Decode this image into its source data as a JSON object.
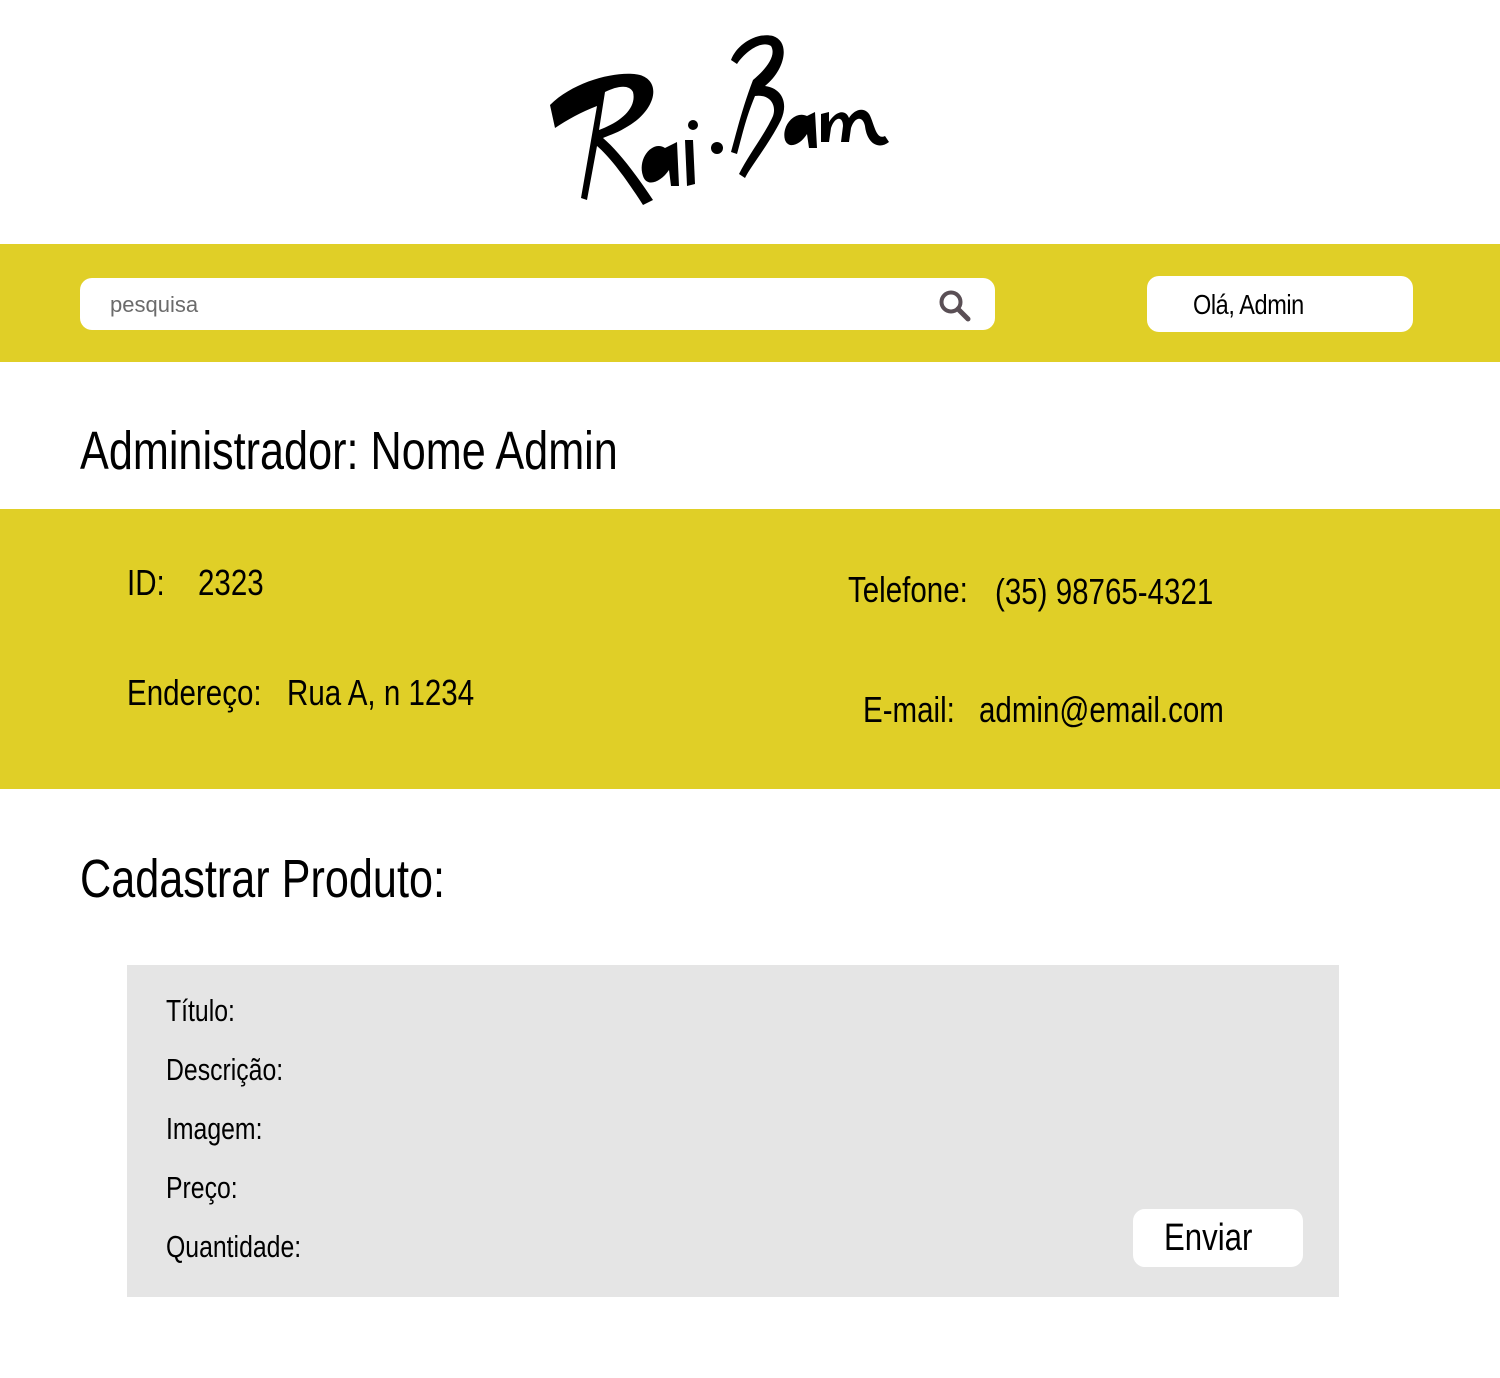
{
  "brand": {
    "logo_text": "Rai-Bam"
  },
  "header": {
    "search": {
      "placeholder": "pesquisa"
    },
    "user_greeting": "Olá, Admin"
  },
  "admin": {
    "title": "Administrador: Nome Admin",
    "fields": {
      "id_label": "ID:",
      "id_value": "2323",
      "address_label": "Endereço:",
      "address_value": "Rua A, n 1234",
      "phone_label": "Telefone:",
      "phone_value": "(35) 98765-4321",
      "email_label": "E-mail:",
      "email_value": "admin@email.com"
    }
  },
  "product_form": {
    "title": "Cadastrar Produto:",
    "labels": {
      "title": "Título:",
      "description": "Descrição:",
      "image": "Imagem:",
      "price": "Preço:",
      "quantity": "Quantidade:"
    },
    "submit_label": "Enviar"
  },
  "colors": {
    "accent_yellow": "#e0cf27",
    "panel_gray": "#e5e5e5",
    "background": "#ffffff",
    "icon_gray": "#5a4f55"
  },
  "icons": {
    "search": "search-icon",
    "logo": "brand-logo"
  }
}
